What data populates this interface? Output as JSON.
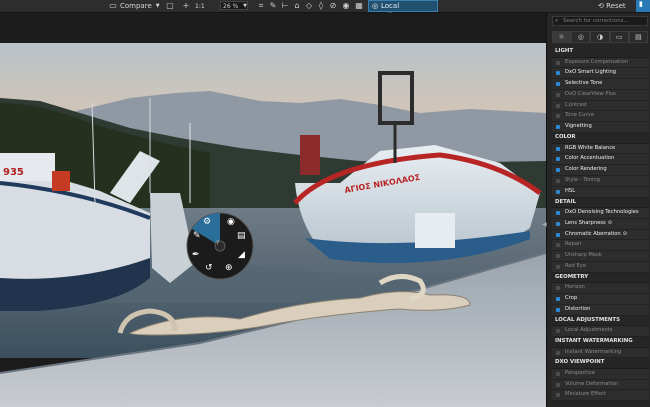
{
  "toolbar": {
    "compare_label": "Compare",
    "one_to_one": "1:1",
    "zoom_value": "26 %",
    "local_adjustments_label": "Local Adjustments",
    "reset_label": "Reset"
  },
  "panel": {
    "search_placeholder": "Search for corrections...",
    "tabs": [
      "☼",
      "◎",
      "◑",
      "▭",
      "▤"
    ],
    "sections": {
      "light": "LIGHT",
      "color": "COLOR",
      "detail": "DETAIL",
      "geometry": "GEOMETRY",
      "local": "LOCAL ADJUSTMENTS",
      "watermark": "INSTANT WATERMARKING",
      "viewpoint": "DXO VIEWPOINT"
    },
    "light_items": [
      "Exposure Compensation",
      "DxO Smart Lighting",
      "Selective Tone",
      "DxO ClearView Plus",
      "Contrast",
      "Tone Curve",
      "Vignetting"
    ],
    "color_items": [
      "RGB White Balance",
      "Color Accentuation",
      "Color Rendering",
      "Style - Toning",
      "HSL"
    ],
    "detail_items": [
      "DxO Denoising Technologies",
      "Lens Sharpness",
      "Chromatic Aberration",
      "Repair",
      "Unsharp Mask",
      "Red Eye"
    ],
    "geometry_items": [
      "Horizon",
      "Crop",
      "Distortion"
    ],
    "local_items": [
      "Local Adjustments"
    ],
    "watermark_items": [
      "Instant Watermarking"
    ],
    "viewpoint_items": [
      "Perspective",
      "Volume Deformation",
      "Miniature Effect"
    ]
  },
  "photo": {
    "boat_left_number": "935",
    "boat_right_name": "ΑΓΙΟΣ ΝΙΚΟΛΑΟΣ"
  },
  "colors": {
    "accent": "#2d88d6",
    "local_adjustments_bg": "#22506f"
  }
}
